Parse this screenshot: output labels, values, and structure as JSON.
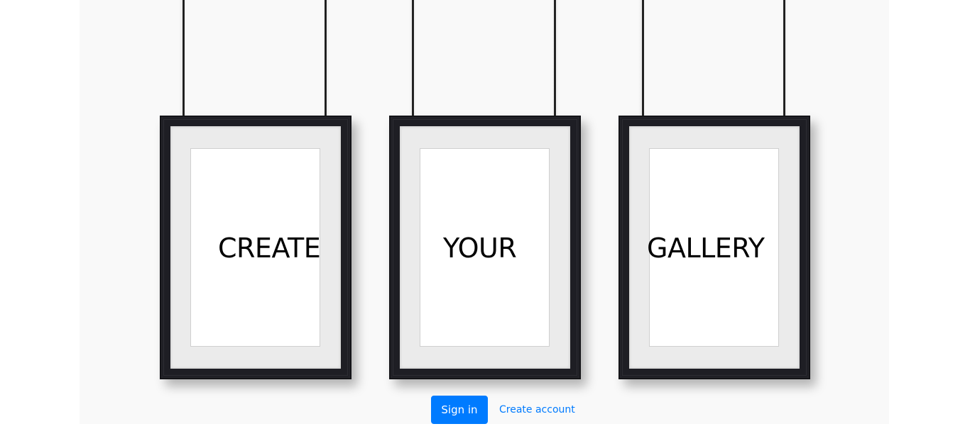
{
  "gallery": {
    "words": [
      "CREATE",
      "YOUR",
      "GALLERY"
    ]
  },
  "actions": {
    "signin_label": "Sign in",
    "create_account_label": "Create account"
  },
  "colors": {
    "primary": "#007bff",
    "frame": "#1e1e24",
    "mat": "#ebebeb",
    "background": "#f9f9f9"
  }
}
